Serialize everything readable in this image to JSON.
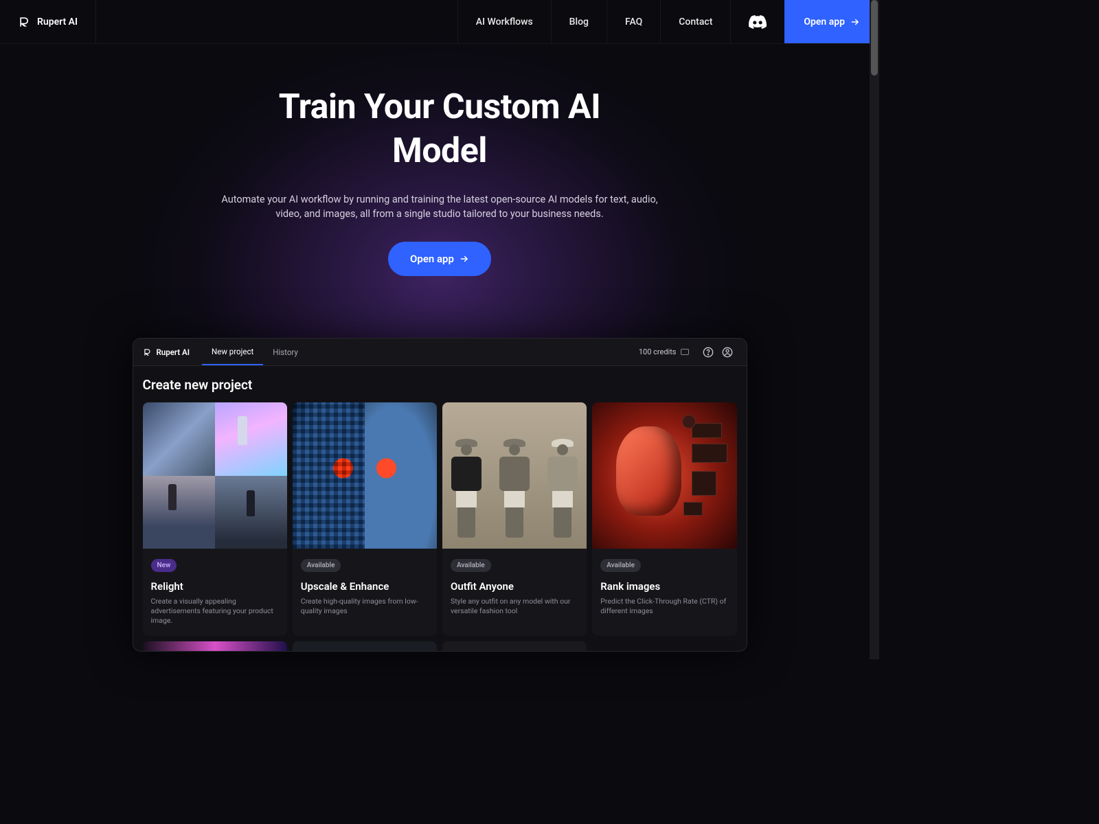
{
  "brand": "Rupert AI",
  "nav": {
    "workflows": "AI Workflows",
    "blog": "Blog",
    "faq": "FAQ",
    "contact": "Contact",
    "open_app": "Open app"
  },
  "hero": {
    "title": "Train Your Custom AI Model",
    "subtitle": "Automate your AI workflow by running and training the latest open-source AI models for text, audio, video, and images, all from a single studio tailored to your business needs.",
    "cta": "Open app"
  },
  "app": {
    "brand": "Rupert AI",
    "tabs": {
      "new_project": "New project",
      "history": "History"
    },
    "credits": "100 credits",
    "heading": "Create new project",
    "badges": {
      "new": "New",
      "available": "Available"
    },
    "cards": [
      {
        "badge": "new",
        "title": "Relight",
        "desc": "Create a visually appealing advertisements featuring your product image."
      },
      {
        "badge": "available",
        "title": "Upscale & Enhance",
        "desc": "Create high-quality images from low-quality images"
      },
      {
        "badge": "available",
        "title": "Outfit Anyone",
        "desc": "Style any outfit on any model with our versatile fashion tool"
      },
      {
        "badge": "available",
        "title": "Rank images",
        "desc": "Predict the Click-Through Rate (CTR) of different images"
      }
    ]
  }
}
